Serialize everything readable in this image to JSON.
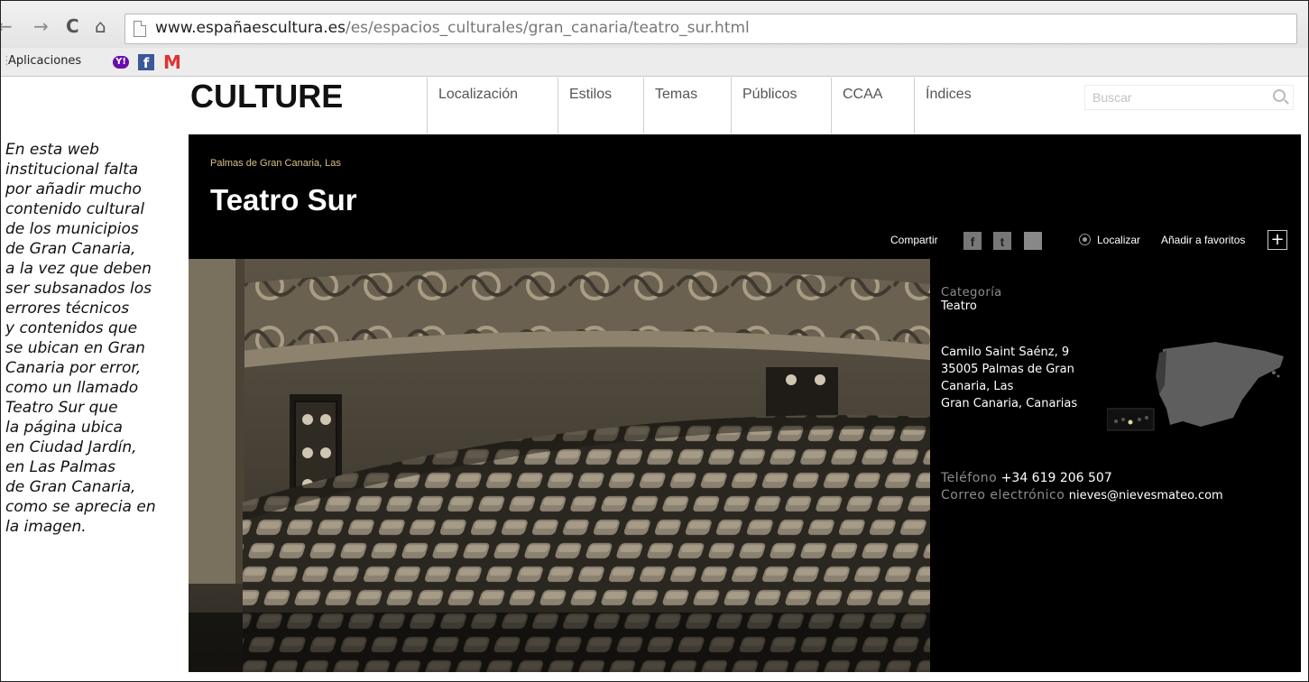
{
  "browser": {
    "back_icon": "arrow-left-icon",
    "forward_icon": "arrow-right-icon",
    "reload_label": "C",
    "home_icon": "home-icon",
    "url_domain": "www.españaescultura.es",
    "url_path": "/es/espacios_culturales/gran_canaria/teatro_sur.html",
    "bookmarks": {
      "apps_label": "Aplicaciones",
      "yahoo_label": "Y!",
      "facebook_label": "f",
      "gmail_label": "M"
    }
  },
  "site": {
    "logo": "CULTURE",
    "nav": [
      "Localización",
      "Estilos",
      "Temas",
      "Públicos",
      "CCAA",
      "Índices"
    ],
    "search_placeholder": "Buscar"
  },
  "annotation": {
    "lines": [
      "En esta web",
      "institucional falta",
      "por añadir mucho",
      "contenido cultural",
      "de los municipios",
      "de Gran Canaria,",
      "a la vez que deben",
      "ser subsanados los",
      "errores técnicos",
      "y contenidos que",
      "se ubican en Gran",
      "Canaria por error,",
      "como un llamado",
      "Teatro Sur que",
      "la página ubica",
      "en Ciudad Jardín,",
      "en Las Palmas",
      "de Gran Canaria,",
      "como se aprecia en",
      "la imagen."
    ]
  },
  "venue": {
    "locality": "Palmas de Gran Canaria, Las",
    "title": "Teatro Sur",
    "share_label": "Compartir",
    "locate_label": "Localizar",
    "favorites_label": "Añadir a favoritos",
    "plus_label": "+",
    "category_label": "Categoría",
    "category_value": "Teatro",
    "address_lines": [
      "Camilo Saint Saénz, 9",
      "35005 Palmas de Gran",
      "Canaria, Las",
      "Gran Canaria, Canarias"
    ],
    "phone_label": "Teléfono",
    "phone_value": "+34 619 206 507",
    "email_label": "Correo electrónico",
    "email_value": "nieves@nievesmateo.com"
  },
  "colors": {
    "panel_bg": "#000000",
    "locality": "#d8c08a",
    "muted_label": "#8d8d8d"
  }
}
